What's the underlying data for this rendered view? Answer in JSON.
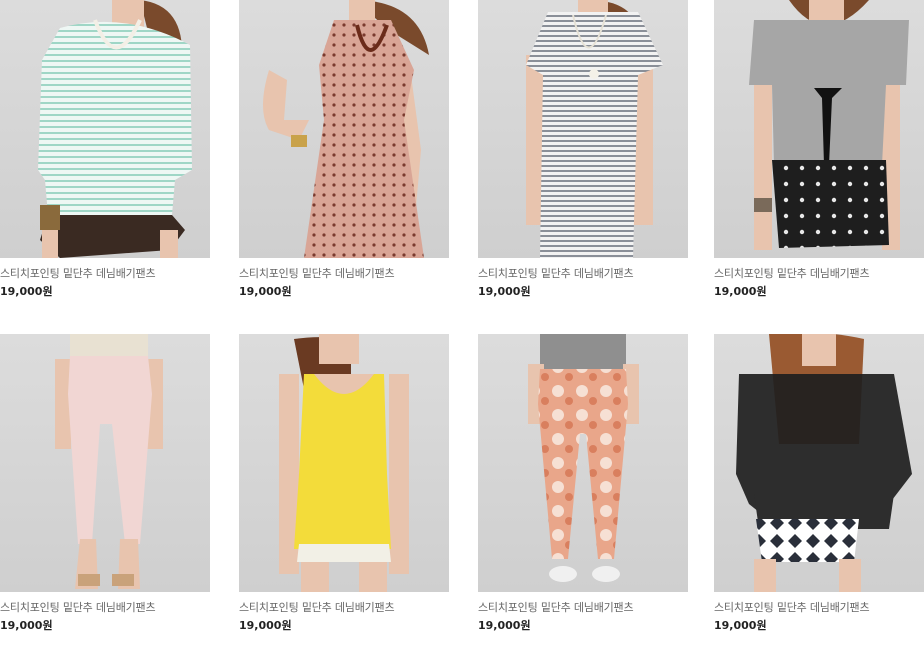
{
  "products": [
    {
      "name": "스티치포인팅 밑단추 데님배기팬츠",
      "price": "19,000원",
      "icon": "striped-top-photo"
    },
    {
      "name": "스티치포인팅 밑단추 데님배기팬츠",
      "price": "19,000원",
      "icon": "polka-dot-dress-photo"
    },
    {
      "name": "스티치포인팅 밑단추 데님배기팬츠",
      "price": "19,000원",
      "icon": "striped-dress-photo"
    },
    {
      "name": "스티치포인팅 밑단추 데님배기팬츠",
      "price": "19,000원",
      "icon": "tie-front-top-photo"
    },
    {
      "name": "스티치포인팅 밑단추 데님배기팬츠",
      "price": "19,000원",
      "icon": "pink-jeans-photo"
    },
    {
      "name": "스티치포인팅 밑단추 데님배기팬츠",
      "price": "19,000원",
      "icon": "yellow-tank-photo"
    },
    {
      "name": "스티치포인팅 밑단추 데님배기팬츠",
      "price": "19,000원",
      "icon": "tie-dye-jeans-photo"
    },
    {
      "name": "스티치포인팅 밑단추 데님배기팬츠",
      "price": "19,000원",
      "icon": "black-sheer-top-photo"
    }
  ]
}
